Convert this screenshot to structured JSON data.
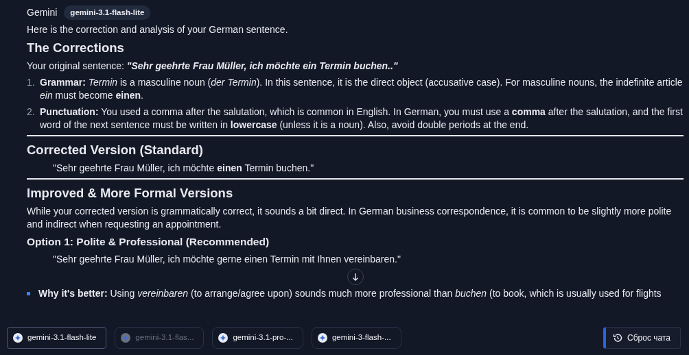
{
  "header": {
    "sender": "Gemini",
    "model_badge": "gemini-3.1-flash-lite"
  },
  "blocks": [
    {
      "kind": "paragraph",
      "text": "Here is the correction and analysis of your German sentence."
    },
    {
      "kind": "heading",
      "text": "The Corrections"
    },
    {
      "kind": "labeled",
      "label": "Your original sentence:",
      "value": "\"Sehr geehrte Frau Müller, ich möchte ein Termin buchen..\""
    },
    {
      "kind": "ordered",
      "items": [
        {
          "number": "1.",
          "text": "**Grammar:** *Termin* is a masculine noun (*der Termin*). In this sentence, it is the direct object (accusative case). For masculine nouns, the indefinite article *ein* must become **einen**."
        },
        {
          "number": "2.",
          "text": "**Punctuation:** You used a comma after the salutation, which is common in English. In German, you must use a **comma** after the salutation, and the first word of the next sentence must be written in **lowercase** (unless it is a noun). Also, avoid double periods at the end."
        }
      ]
    },
    {
      "kind": "rule"
    },
    {
      "kind": "heading",
      "text": "Corrected Version (Standard)"
    },
    {
      "kind": "quote",
      "text": "\"Sehr geehrte Frau Müller, ich möchte **einen** Termin buchen.\""
    },
    {
      "kind": "rule"
    },
    {
      "kind": "heading",
      "text": "Improved & More Formal Versions"
    },
    {
      "kind": "paragraph",
      "text": "While your corrected version is grammatically correct, it sounds a bit direct. In German business correspondence, it is common to be slightly more polite and indirect when requesting an appointment."
    },
    {
      "kind": "subheading",
      "text": "Option 1: Polite & Professional (Recommended)"
    },
    {
      "kind": "quote",
      "text": "\"Sehr geehrte Frau Müller, ich möchte gerne einen Termin mit Ihnen vereinbaren.\""
    },
    {
      "kind": "bullets",
      "items": [
        {
          "text": "**Why it's better:** Using *vereinbaren* (to arrange/agree upon) sounds much more professional than *buchen* (to book, which is usually used for flights"
        }
      ]
    }
  ],
  "model_chips": [
    {
      "label": "gemini-3.1-flash-lite",
      "selected": true,
      "disabled": false
    },
    {
      "label": "gemini-3.1-flas...",
      "selected": false,
      "disabled": true
    },
    {
      "label": "gemini-3.1-pro-...",
      "selected": false,
      "disabled": false
    },
    {
      "label": "gemini-3-flash-...",
      "selected": false,
      "disabled": false
    }
  ],
  "reset_button": {
    "label": "Сброс чата"
  }
}
